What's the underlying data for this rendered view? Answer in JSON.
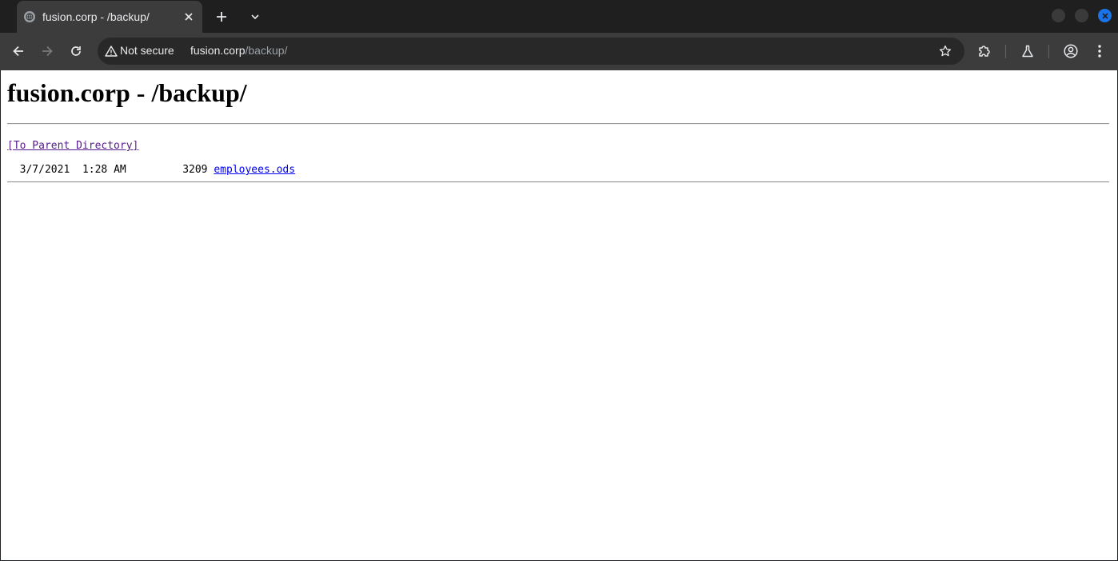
{
  "tab": {
    "title": "fusion.corp - /backup/"
  },
  "omnibox": {
    "security_label": "Not secure",
    "url_host": "fusion.corp",
    "url_path": "/backup/"
  },
  "page": {
    "heading": "fusion.corp - /backup/",
    "parent_link": "[To Parent Directory]",
    "entries": [
      {
        "date": "3/7/2021",
        "time": "1:28 AM",
        "size": "3209",
        "name": "employees.ods"
      }
    ]
  },
  "colors": {
    "visited_link": "#551a8b",
    "link": "#0000ee",
    "accent": "#1a73e8"
  }
}
